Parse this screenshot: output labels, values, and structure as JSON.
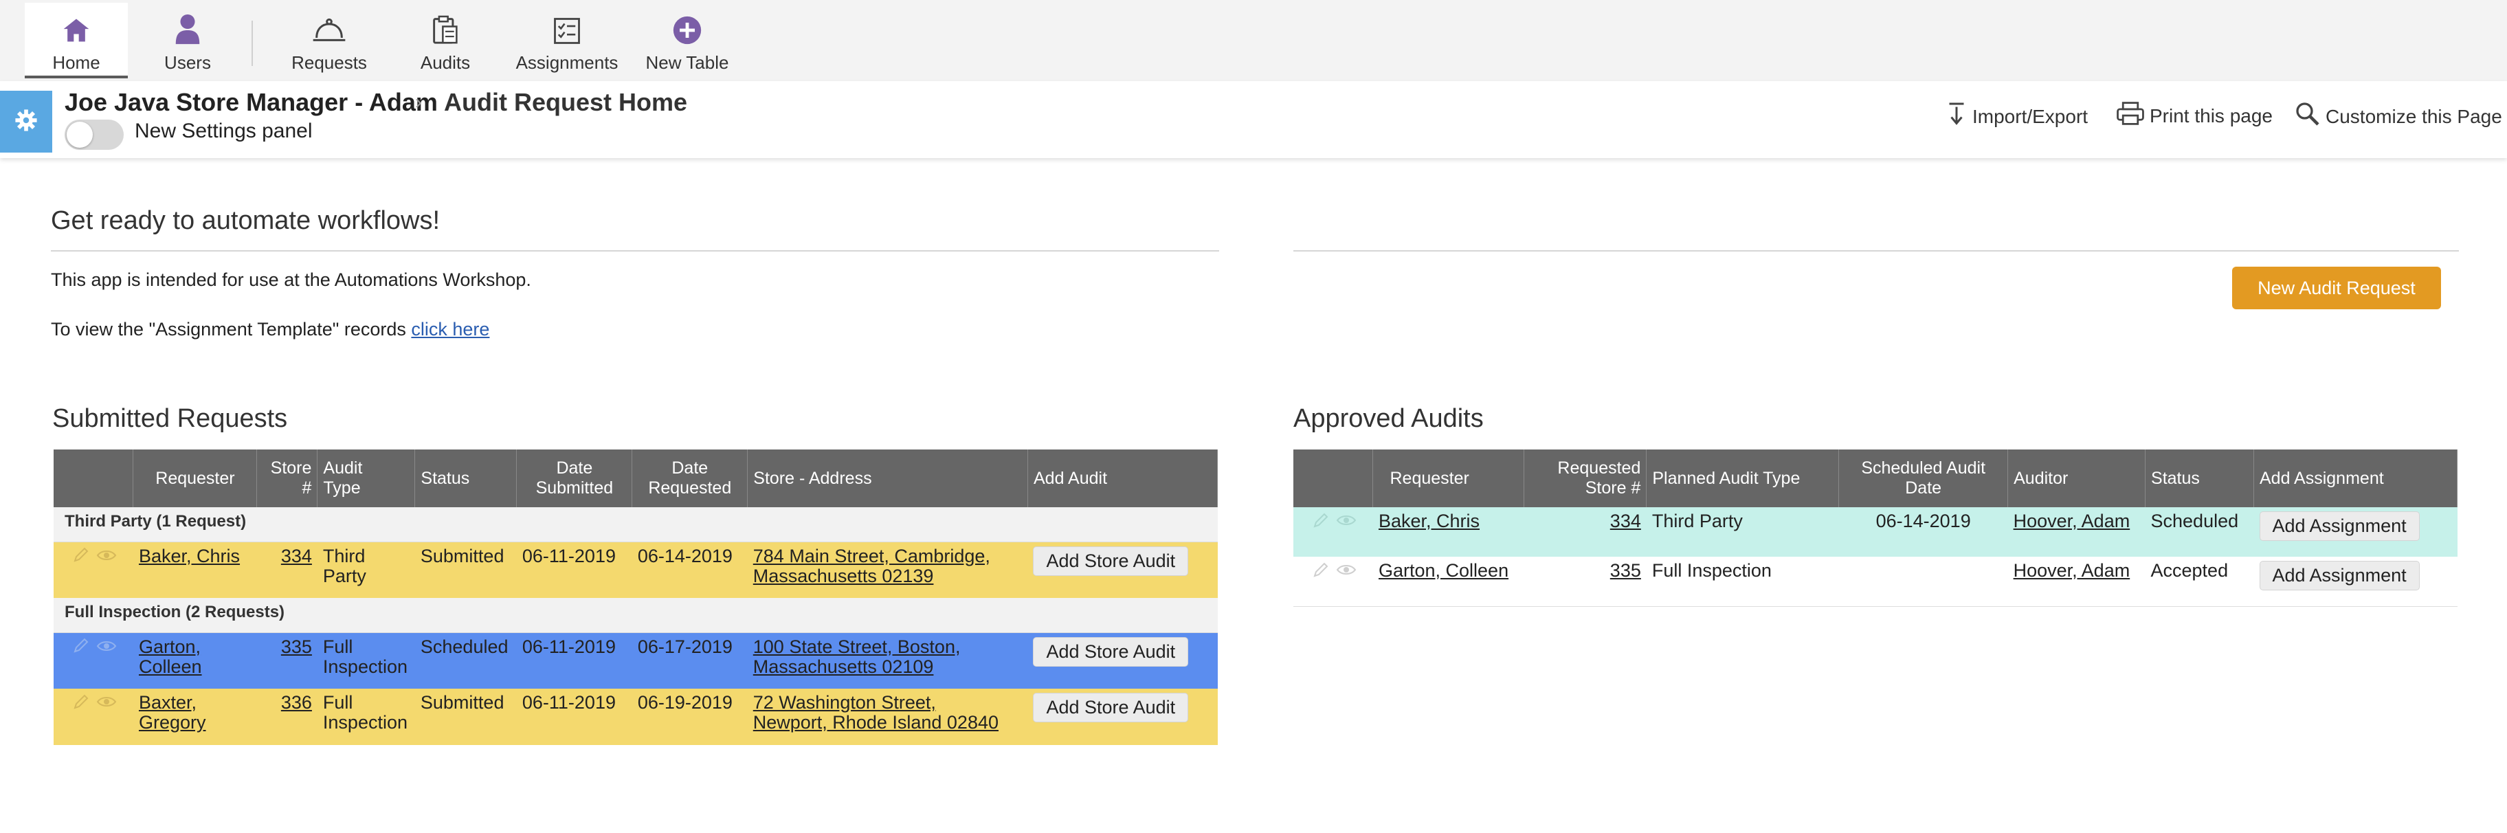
{
  "nav": {
    "items": [
      {
        "label": "Home"
      },
      {
        "label": "Users"
      },
      {
        "label": "Requests"
      },
      {
        "label": "Audits"
      },
      {
        "label": "Assignments"
      },
      {
        "label": "New Table"
      }
    ]
  },
  "header": {
    "breadcrumb_app": "Joe Java Store Manager - Adam",
    "breadcrumb_sep": "›",
    "page_title": "Audit Request Home",
    "settings_toggle_label": "New Settings panel",
    "actions": {
      "import_export": "Import/Export",
      "print": "Print this page",
      "customize": "Customize this Page"
    }
  },
  "welcome": {
    "title": "Get ready to automate workflows!",
    "line1": "This app is intended for use at the Automations Workshop.",
    "line2_prefix": "To view the \"Assignment Template\" records ",
    "line2_link": "click here"
  },
  "new_audit_button": "New Audit Request",
  "submitted": {
    "title": "Submitted Requests",
    "columns": [
      "Requester",
      "Store #",
      "Audit Type",
      "Status",
      "Date Submitted",
      "Date Requested",
      "Store - Address",
      "Add Audit"
    ],
    "col_lines": {
      "store": [
        "Store",
        "#"
      ],
      "audit_type": [
        "Audit",
        "Type"
      ],
      "date_submitted": [
        "Date",
        "Submitted"
      ],
      "date_requested": [
        "Date",
        "Requested"
      ]
    },
    "groups": [
      {
        "label": "Third Party",
        "count": "(1 Request)",
        "rows": [
          {
            "requester": [
              "Baker, Chris"
            ],
            "store": "334",
            "type": [
              "Third",
              "Party"
            ],
            "status": "Submitted",
            "submitted": "06-11-2019",
            "requested": "06-14-2019",
            "address": [
              "784 Main Street, Cambridge,",
              "Massachusetts 02139"
            ],
            "button": "Add  Store Audit"
          }
        ]
      },
      {
        "label": "Full Inspection",
        "count": "(2 Requests)",
        "rows": [
          {
            "requester": [
              "Garton,",
              "Colleen"
            ],
            "store": "335",
            "type": [
              "Full",
              "Inspection"
            ],
            "status": "Scheduled",
            "submitted": "06-11-2019",
            "requested": "06-17-2019",
            "address": [
              "100 State Street, Boston,",
              "Massachusetts 02109"
            ],
            "button": "Add  Store Audit"
          },
          {
            "requester": [
              "Baxter,",
              "Gregory"
            ],
            "store": "336",
            "type": [
              "Full",
              "Inspection"
            ],
            "status": "Submitted",
            "submitted": "06-11-2019",
            "requested": "06-19-2019",
            "address": [
              "72 Washington Street,",
              "Newport, Rhode Island 02840"
            ],
            "button": "Add  Store Audit"
          }
        ]
      }
    ]
  },
  "approved": {
    "title": "Approved Audits",
    "columns": [
      "Requester",
      "Requested Store #",
      "Planned Audit Type",
      "Scheduled Audit Date",
      "Auditor",
      "Status",
      "Add Assignment"
    ],
    "col_lines": {
      "requested_store": [
        "Requested",
        "Store #"
      ],
      "scheduled_date": [
        "Scheduled Audit",
        "Date"
      ]
    },
    "rows": [
      {
        "requester": "Baker, Chris",
        "store": "334",
        "type": "Third Party",
        "date": "06-14-2019",
        "auditor": "Hoover, Adam",
        "status": "Scheduled",
        "button": "Add  Assignment"
      },
      {
        "requester": "Garton, Colleen",
        "store": "335",
        "type": "Full Inspection",
        "date": "",
        "auditor": "Hoover, Adam",
        "status": "Accepted",
        "button": "Add  Assignment"
      }
    ]
  },
  "colors": {
    "accent_purple": "#7b5ea7",
    "settings_blue": "#5aa8e2",
    "primary_button": "#e39a22",
    "row_yellow": "#f4d96e",
    "row_blue": "#5b8def",
    "row_teal": "#c6f1ea",
    "table_header": "#666666"
  },
  "icons": {
    "home": "home-icon",
    "users": "user-icon",
    "requests": "service-bell-icon",
    "audits": "clipboard-icon",
    "assignments": "checklist-icon",
    "new_table": "plus-circle-icon",
    "settings": "gear-icon",
    "import_export": "import-export-icon",
    "print": "printer-icon",
    "customize": "magnify-icon",
    "edit": "pencil-icon",
    "view": "eye-icon"
  }
}
